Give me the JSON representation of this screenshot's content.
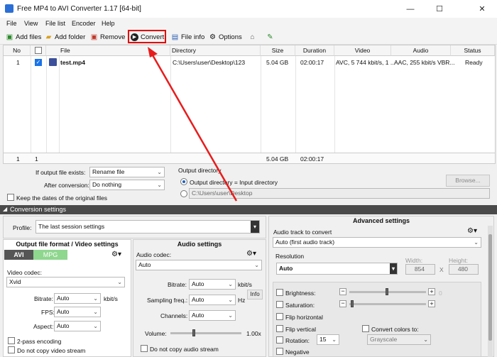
{
  "window": {
    "title": "Free MP4 to AVI Converter 1.17  [64-bit]",
    "minimize": "—",
    "maximize": "☐",
    "close": "✕"
  },
  "menu": [
    "File",
    "View",
    "File list",
    "Encoder",
    "Help"
  ],
  "toolbar": {
    "add_files": "Add files",
    "add_folder": "Add folder",
    "remove": "Remove",
    "convert": "Convert",
    "file_info": "File info",
    "options": "Options"
  },
  "grid": {
    "headers": [
      "No",
      "",
      "File",
      "Directory",
      "Size",
      "Duration",
      "Video",
      "Audio",
      "Status"
    ],
    "rows": [
      {
        "no": "1",
        "checked": true,
        "file": "test.mp4",
        "directory": "C:\\Users\\user\\Desktop\\123",
        "size": "5.04 GB",
        "duration": "02:00:17",
        "video": "AVC, 5 744 kbit/s, 1 ...",
        "audio": "AAC, 255 kbit/s VBR...",
        "status": "Ready"
      }
    ],
    "footer": {
      "count": "1",
      "checked": "1",
      "size": "5.04 GB",
      "duration": "02:00:17"
    }
  },
  "output": {
    "if_exists_label": "If output file exists:",
    "if_exists_value": "Rename file",
    "after_conversion_label": "After conversion:",
    "after_conversion_value": "Do nothing",
    "keep_dates": "Keep the dates of the original files",
    "dir_title": "Output directory",
    "dir_input_option": "Output directory = Input directory",
    "dir_path": "C:\\Users\\user\\Desktop",
    "browse": "Browse..."
  },
  "conv": {
    "title": "Conversion settings",
    "profile_label": "Profile:",
    "profile_value": "The last session settings",
    "format_title": "Output file format / Video settings",
    "tab_avi": "AVI",
    "tab_mpg": "MPG",
    "video_codec_label": "Video codec:",
    "video_codec_value": "Xvid",
    "bitrate_label": "Bitrate:",
    "bitrate_value": "Auto",
    "bitrate_unit": "kbit/s",
    "fps_label": "FPS:",
    "fps_value": "Auto",
    "aspect_label": "Aspect:",
    "aspect_value": "Auto",
    "two_pass": "2-pass encoding",
    "no_copy_video": "Do not copy video stream",
    "audio_title": "Audio settings",
    "audio_codec_label": "Audio codec:",
    "audio_codec_value": "Auto",
    "a_bitrate_label": "Bitrate:",
    "a_bitrate_value": "Auto",
    "a_bitrate_unit": "kbit/s",
    "sampling_label": "Sampling freq.:",
    "sampling_value": "Auto",
    "sampling_unit": "Hz",
    "info": "Info",
    "channels_label": "Channels:",
    "channels_value": "Auto",
    "volume_label": "Volume:",
    "volume_value": "1.00x",
    "no_copy_audio": "Do not copy audio stream",
    "adv_title": "Advanced settings",
    "audio_track_label": "Audio track to convert",
    "audio_track_value": "Auto (first audio track)",
    "resolution_label": "Resolution",
    "resolution_value": "Auto",
    "width_label": "Width:",
    "width_value": "854",
    "x": "X",
    "height_label": "Height:",
    "height_value": "480",
    "brightness": "Brightness:",
    "brightness_value": "0",
    "saturation": "Saturation:",
    "saturation_value": "",
    "flip_h": "Flip horizontal",
    "flip_v": "Flip vertical",
    "convert_colors": "Convert colors to:",
    "colors_value": "Grayscale",
    "rotation": "Rotation:",
    "rotation_value": "15",
    "negative": "Negative"
  }
}
